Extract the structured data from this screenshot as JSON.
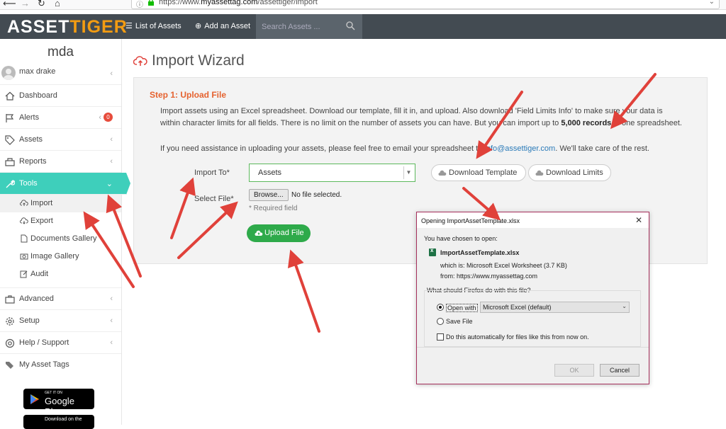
{
  "browser": {
    "url_prefix": "https://www.",
    "url_domain": "myassettag.com",
    "url_path": "/assettiger/import"
  },
  "header": {
    "logo_part1": "ASSET",
    "logo_part2": "TIGER",
    "nav_list": "List of Assets",
    "nav_add": "Add an Asset",
    "search_placeholder": "Search Assets ..."
  },
  "sidebar": {
    "company": "mda",
    "user_name": "max drake",
    "items": {
      "dashboard": "Dashboard",
      "alerts": "Alerts",
      "alerts_count": "0",
      "assets": "Assets",
      "reports": "Reports",
      "tools": "Tools",
      "advanced": "Advanced",
      "setup": "Setup",
      "help": "Help / Support",
      "tags": "My Asset Tags"
    },
    "tools_sub": {
      "import": "Import",
      "export": "Export",
      "documents": "Documents Gallery",
      "images": "Image Gallery",
      "audit": "Audit"
    },
    "google_small": "GET IT ON",
    "google_big": "Google Play",
    "apple_small": "Download on the"
  },
  "main": {
    "title": "Import Wizard",
    "step_title": "Step 1: Upload File",
    "para1_a": "Import assets using an Excel spreadsheet. Download our template, fill it in, and upload. Also download 'Field Limits Info' to make sure your data is",
    "para1_b": "within character limits for all fields. There is no limit on the number of assets you can have. But you can import up to ",
    "para1_bold": "5,000 records",
    "para1_c": " in one spreadsheet.",
    "para2_a": "If you need assistance in uploading your assets, please feel free to email your spreadsheet to ",
    "para2_mail": "info@assettiger.com",
    "para2_b": ". We'll take care of the rest.",
    "import_to_label": "Import To*",
    "import_to_value": "Assets",
    "download_template": "Download Template",
    "download_limits": "Download Limits",
    "select_file_label": "Select File*",
    "browse": "Browse...",
    "no_file": "No file selected.",
    "required_note": "* Required field",
    "upload_button": "Upload File"
  },
  "dialog": {
    "title": "Opening ImportAssetTemplate.xlsx",
    "chosen": "You have chosen to open:",
    "filename": "ImportAssetTemplate.xlsx",
    "which_is": "which is:  Microsoft Excel Worksheet (3.7 KB)",
    "from": "from:  https://www.myassettag.com",
    "question": "What should Firefox do with this file?",
    "open_with": "Open with",
    "open_with_app": "Microsoft Excel (default)",
    "save_file": "Save File",
    "auto": "Do this automatically for files like this from now on.",
    "ok": "OK",
    "cancel": "Cancel"
  },
  "colors": {
    "header_bg": "#434b52",
    "accent_teal": "#3ecfbb",
    "step_orange": "#e5622f",
    "upload_green": "#2eaa4a",
    "arrow_red": "#e0413a"
  }
}
